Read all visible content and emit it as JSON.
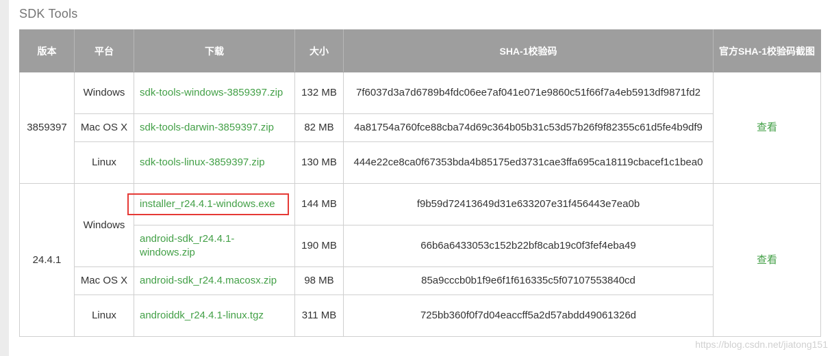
{
  "section": {
    "title": "SDK Tools"
  },
  "table": {
    "headers": {
      "version": "版本",
      "platform": "平台",
      "download": "下载",
      "size": "大小",
      "sha1": "SHA-1校验码",
      "screenshot": "官方SHA-1校验码截图"
    },
    "groups": [
      {
        "version": "3859397",
        "view": "查看",
        "rows": [
          {
            "platform": "Windows",
            "file": "sdk-tools-windows-3859397.zip",
            "size": "132 MB",
            "sha1": "7f6037d3a7d6789b4fdc06ee7af041e071e9860c51f66f7a4eb5913df9871fd2"
          },
          {
            "platform": "Mac OS X",
            "file": "sdk-tools-darwin-3859397.zip",
            "size": "82 MB",
            "sha1": "4a81754a760fce88cba74d69c364b05b31c53d57b26f9f82355c61d5fe4b9df9"
          },
          {
            "platform": "Linux",
            "file": "sdk-tools-linux-3859397.zip",
            "size": "130 MB",
            "sha1": "444e22ce8ca0f67353bda4b85175ed3731cae3ffa695ca18119cbacef1c1bea0"
          }
        ]
      },
      {
        "version": "24.4.1",
        "view": "查看",
        "windows_platform": "Windows",
        "rows": [
          {
            "platform": "Windows",
            "file": "installer_r24.4.1-windows.exe",
            "size": "144 MB",
            "sha1": "f9b59d72413649d31e633207e31f456443e7ea0b"
          },
          {
            "platform": "Windows",
            "file": "android-sdk_r24.4.1-windows.zip",
            "size": "190 MB",
            "sha1": "66b6a6433053c152b22bf8cab19c0f3fef4eba49"
          },
          {
            "platform": "Mac OS X",
            "file": "android-sdk_r24.4.macosx.zip",
            "size": "98 MB",
            "sha1": "85a9cccb0b1f9e6f1f616335c5f07107553840cd"
          },
          {
            "platform": "Linux",
            "file": "androiddk_r24.4.1-linux.tgz",
            "size": "311 MB",
            "sha1": "725bb360f0f7d04eaccff5a2d57abdd49061326d"
          }
        ]
      }
    ]
  },
  "watermark": "https://blog.csdn.net/jiatong151",
  "colors": {
    "header_bg": "#9e9e9e",
    "link": "#43a047",
    "highlight": "#e53935",
    "border": "#cfcfcf"
  }
}
